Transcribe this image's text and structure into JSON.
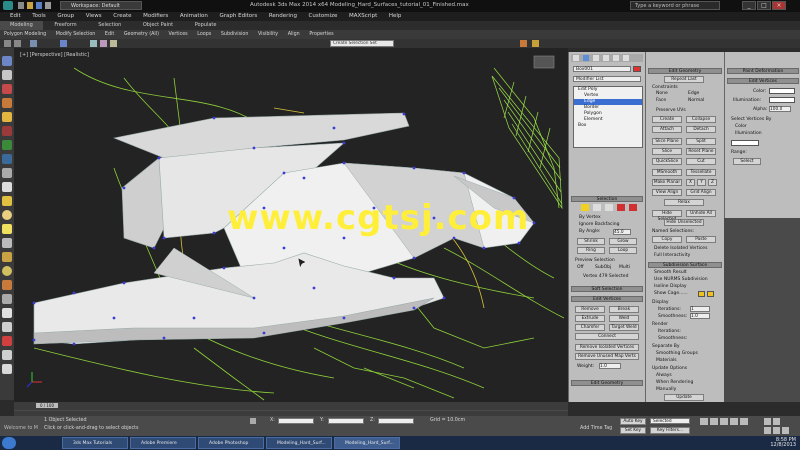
{
  "window": {
    "title": "Autodesk 3ds Max 2014 x64   Modeling_Hard_Surfaces_tutorial_01_Finished.max",
    "workspace": "Workspace: Default",
    "search_placeholder": "Type a keyword or phrase"
  },
  "menu": [
    "Edit",
    "Tools",
    "Group",
    "Views",
    "Create",
    "Modifiers",
    "Animation",
    "Graph Editors",
    "Rendering",
    "Customize",
    "MAXScript",
    "Help"
  ],
  "ribbon": {
    "tabs": [
      "Modeling",
      "Freeform",
      "Selection",
      "Object Paint",
      "Populate"
    ],
    "sub": [
      "Polygon Modeling",
      "Modify Selection",
      "Edit",
      "Geometry (All)",
      "Vertices",
      "Loops",
      "Subdivision",
      "Visibility",
      "Align",
      "Properties"
    ],
    "named_selection": "Create Selection Set"
  },
  "viewport": {
    "label": "[+] [Perspective] [Realistic]"
  },
  "watermark": "www.cgtsj.com",
  "panel1": {
    "object_name": "Box001",
    "modifier_list": "Modifier List",
    "stack": [
      "Edit Poly",
      "Vertex",
      "Edge",
      "Border",
      "Polygon",
      "Element",
      "Box"
    ],
    "selection_title": "Selection",
    "by_vertex": "By Vertex",
    "ignore_backfacing": "Ignore Backfacing",
    "by_angle": "By Angle:",
    "angle_val": "45.0",
    "shrink": "Shrink",
    "grow": "Grow",
    "ring": "Ring",
    "loop": "Loop",
    "preview_selection": "Preview Selection",
    "off": "Off",
    "subobj": "SubObj",
    "multi": "Multi",
    "selected_text": "Vertex 479 Selected",
    "soft_selection": "Soft Selection",
    "edit_vertices": "Edit Vertices",
    "remove": "Remove",
    "break": "Break",
    "extrude": "Extrude",
    "weld": "Weld",
    "chamfer": "Chamfer",
    "target_weld": "Target Weld",
    "connect": "Connect",
    "remove_isolated": "Remove Isolated Vertices",
    "remove_unused": "Remove Unused Map Verts",
    "weight": "Weight:",
    "weight_val": "1.0"
  },
  "panel2": {
    "edit_geometry": "Edit Geometry",
    "repeat_last": "Repeat Last",
    "constraints": "Constraints",
    "none": "None",
    "edge": "Edge",
    "face": "Face",
    "normal": "Normal",
    "preserve_uvs": "Preserve UVs",
    "create": "Create",
    "collapse": "Collapse",
    "attach": "Attach",
    "detach": "Detach",
    "slice_plane": "Slice Plane",
    "split": "Split",
    "slice": "Slice",
    "reset_plane": "Reset Plane",
    "quickslice": "QuickSlice",
    "cut": "Cut",
    "msmooth": "MSmooth",
    "tessellate": "Tessellate",
    "make_planar": "Make Planar",
    "x": "X",
    "y": "Y",
    "z": "Z",
    "view_align": "View Align",
    "grid_align": "Grid Align",
    "relax": "Relax",
    "hide_selected": "Hide Selected",
    "unhide_all": "Unhide All",
    "hide_unselected": "Hide Unselected",
    "named_selections": "Named Selections:",
    "copy": "Copy",
    "paste": "Paste",
    "delete_isolated": "Delete Isolated Vertices",
    "full_interactivity": "Full Interactivity",
    "subdivision_surface": "Subdivision Surface",
    "smooth_result": "Smooth Result",
    "use_nurms": "Use NURMS Subdivision",
    "isoline_display": "Isoline Display",
    "show_cage": "Show Cage......",
    "display": "Display",
    "iterations": "Iterations:",
    "iterations_val": "1",
    "smoothness": "Smoothness:",
    "smoothness_val": "1.0",
    "render": "Render",
    "separate_by": "Separate By",
    "smoothing_groups": "Smoothing Groups",
    "materials": "Materials",
    "update_options": "Update Options",
    "always": "Always",
    "when_rendering": "When Rendering",
    "manually": "Manually",
    "update": "Update"
  },
  "panel3": {
    "paint_deformation": "Paint Deformation",
    "edit_vertices": "Edit Vertices",
    "vertex_color": "Color:",
    "illumination": "Illumination:",
    "alpha": "Alpha:",
    "alpha_val": "100.0",
    "select_vertices_by": "Select Vertices By",
    "color": "Color",
    "illumination_radio": "Illumination",
    "range": "Range:",
    "select": "Select"
  },
  "timeline": {
    "frame": "0 / 100"
  },
  "status": {
    "selected": "1 Object Selected",
    "hint": "Click or click-and-drag to select objects",
    "x_label": "X:",
    "y_label": "Y:",
    "z_label": "Z:",
    "grid": "Grid = 10.0cm",
    "auto_key": "Auto Key",
    "selected_dd": "Selected",
    "set_key": "Set Key",
    "key_filters": "Key Filters...",
    "add_time_tag": "Add Time Tag",
    "welcome": "Welcome to M"
  },
  "taskbar": {
    "items": [
      "3ds Max Tutorials",
      "Adobe Premiere",
      "Adobe Photoshop",
      "Modeling_Hard_Surf...",
      "Modeling_Hard_Surf..."
    ],
    "time": "8:58 PM",
    "date": "12/8/2013"
  },
  "colors": {
    "viewport_bg": "#232323",
    "wire_green": "#8fd23a",
    "vertex_blue": "#3b3bd8",
    "watermark": "#ffef3a"
  }
}
